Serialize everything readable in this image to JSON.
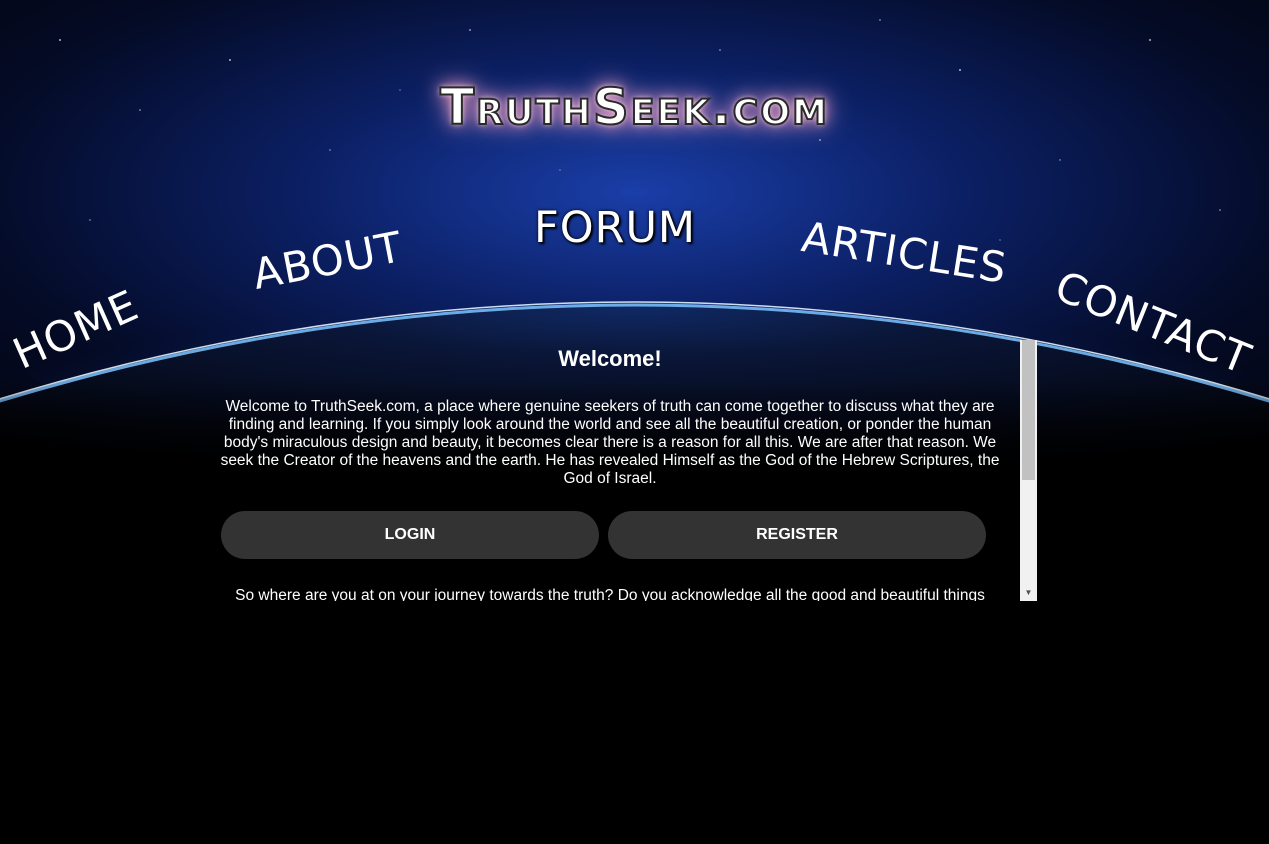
{
  "site": {
    "logo_text": "TruthSeek.com"
  },
  "nav": {
    "home": "HOME",
    "about": "ABOUT",
    "forum": "FORUM",
    "articles": "ARTICLES",
    "contact": "CONTACT"
  },
  "welcome": {
    "title": "Welcome!",
    "body": "Welcome to TruthSeek.com, a place where genuine seekers of truth can come together to discuss what they are finding and learning. If you simply look around the world and see all the beautiful creation, or ponder the human body's miraculous design and beauty, it becomes clear there is a reason for all this. We are after that reason. We seek the Creator of the heavens and the earth. He has revealed Himself as the God of the Hebrew Scriptures, the God of Israel.",
    "login_label": "LOGIN",
    "register_label": "REGISTER",
    "journey_text": "So where are you at on your journey towards the truth? Do you acknowledge all the good and beautiful things"
  },
  "scrollbar": {
    "down_arrow_icon": "caret-down-icon"
  },
  "colors": {
    "background": "#000000",
    "button": "#333333",
    "glow_blue": "#2a8cff",
    "logo_glow": "#ff9fc7"
  }
}
